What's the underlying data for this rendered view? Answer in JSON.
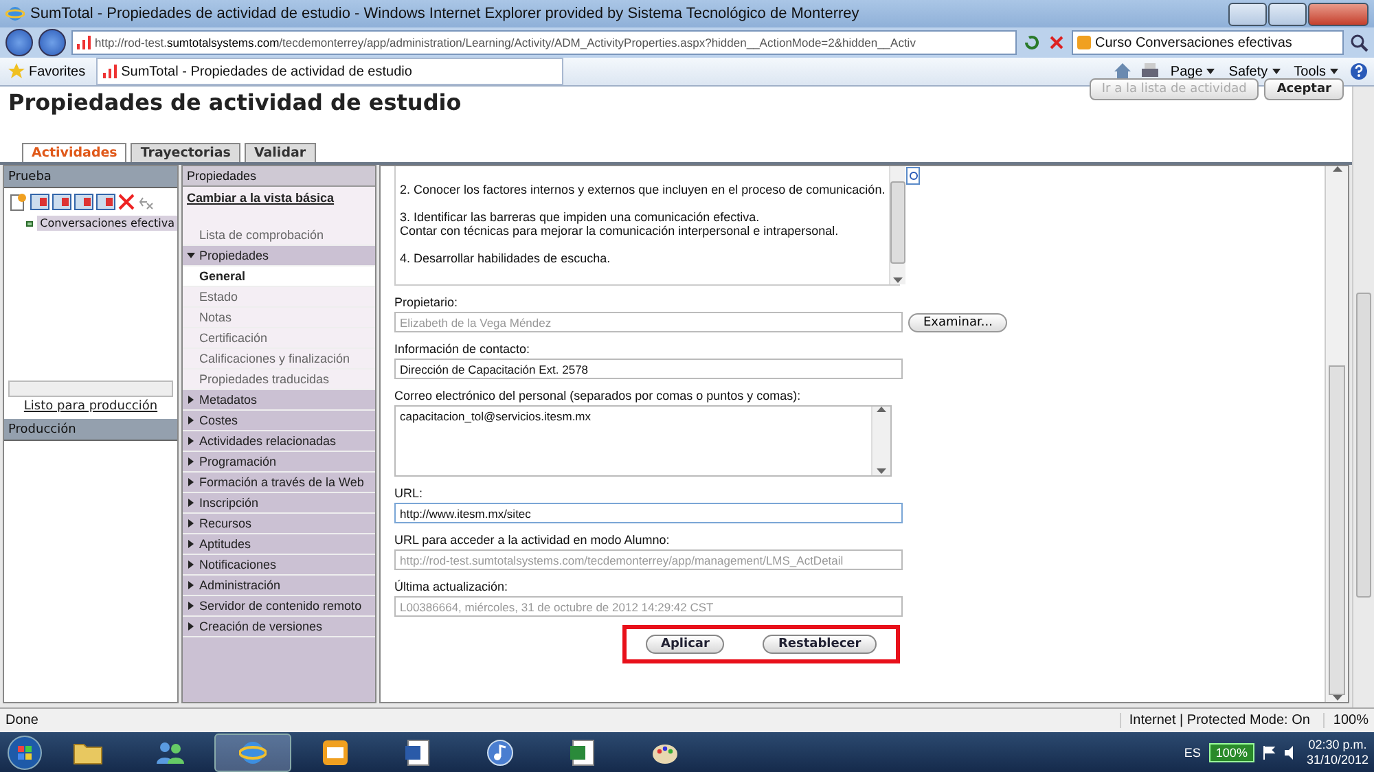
{
  "window": {
    "title": "SumTotal - Propiedades de actividad de estudio - Windows Internet Explorer provided by Sistema Tecnológico de Monterrey"
  },
  "address_bar": {
    "url_start": "http://rod-test.",
    "url_domain": "sumtotalsystems.com",
    "url_rest": "/tecdemonterrey/app/administration/Learning/Activity/ADM_ActivityProperties.aspx?hidden__ActionMode=2&hidden__Activ"
  },
  "search_field": {
    "value": "Curso Conversaciones efectivas"
  },
  "favorites_bar": {
    "favorites": "Favorites",
    "tab": "SumTotal - Propiedades de actividad de estudio",
    "commands": [
      "Page",
      "Safety",
      "Tools"
    ]
  },
  "page": {
    "heading": "Propiedades de actividad de estudio",
    "top_buttons": [
      {
        "label": "Ir a la lista de actividad",
        "disabled": true
      },
      {
        "label": "Aceptar",
        "disabled": false
      }
    ]
  },
  "tabs": [
    {
      "label": "Actividades",
      "selected": true
    },
    {
      "label": "Trayectorias",
      "selected": false
    },
    {
      "label": "Validar",
      "selected": false
    }
  ],
  "left_panel": {
    "title": "Prueba",
    "tree_item": "Conversaciones efectiva",
    "link": "Listo para producción",
    "second_title": "Producción"
  },
  "nav": {
    "header": "Propiedades",
    "link": "Cambiar a la vista básica",
    "items": [
      {
        "kind": "page",
        "label": "Lista de comprobación",
        "selected": false
      },
      {
        "kind": "section",
        "label": "Propiedades",
        "expanded": true,
        "children": [
          {
            "label": "General",
            "selected": true
          },
          {
            "label": "Estado",
            "selected": false
          },
          {
            "label": "Notas",
            "selected": false
          },
          {
            "label": "Certificación",
            "selected": false
          },
          {
            "label": "Calificaciones y finalización",
            "selected": false
          },
          {
            "label": "Propiedades traducidas",
            "selected": false
          }
        ]
      },
      {
        "kind": "section",
        "label": "Metadatos",
        "expanded": false
      },
      {
        "kind": "section",
        "label": "Costes",
        "expanded": false
      },
      {
        "kind": "section",
        "label": "Actividades relacionadas",
        "expanded": false
      },
      {
        "kind": "section",
        "label": "Programación",
        "expanded": false
      },
      {
        "kind": "section",
        "label": "Formación a través de la Web",
        "expanded": false
      },
      {
        "kind": "section",
        "label": "Inscripción",
        "expanded": false
      },
      {
        "kind": "section",
        "label": "Recursos",
        "expanded": false
      },
      {
        "kind": "section",
        "label": "Aptitudes",
        "expanded": false
      },
      {
        "kind": "section",
        "label": "Notificaciones",
        "expanded": false
      },
      {
        "kind": "section",
        "label": "Administración",
        "expanded": false
      },
      {
        "kind": "section",
        "label": "Servidor de contenido remoto",
        "expanded": false
      },
      {
        "kind": "section",
        "label": "Creación de versiones",
        "expanded": false
      }
    ]
  },
  "objectives": [
    {
      "lines": [
        "2. Conocer los factores internos y externos que incluyen en el proceso de comunicación."
      ]
    },
    {
      "lines": [
        "3. Identificar las barreras que impiden una comunicación efectiva.",
        "Contar con técnicas para mejorar la comunicación interpersonal e intrapersonal."
      ]
    },
    {
      "lines": [
        "4. Desarrollar habilidades de escucha."
      ]
    }
  ],
  "fields": [
    {
      "kind": "input",
      "label": "Propietario:",
      "value": "Elizabeth de la Vega Méndez",
      "disabled": true,
      "focused": false,
      "button": "Examinar..."
    },
    {
      "kind": "input",
      "label": "Información de contacto:",
      "value": "Dirección de Capacitación Ext. 2578",
      "disabled": false,
      "focused": false
    },
    {
      "kind": "textarea",
      "label": "Correo electrónico del personal (separados por comas o puntos y comas):",
      "value": "capacitacion_tol@servicios.itesm.mx",
      "disabled": false,
      "focused": false
    },
    {
      "kind": "input",
      "label": "URL:",
      "value": "http://www.itesm.mx/sitec",
      "disabled": false,
      "focused": true
    },
    {
      "kind": "input",
      "label": "URL para acceder a la actividad en modo Alumno:",
      "value": "http://rod-test.sumtotalsystems.com/tecdemonterrey/app/management/LMS_ActDetail",
      "disabled": true,
      "focused": false
    },
    {
      "kind": "input",
      "label": "Última actualización:",
      "value": "L00386664, miércoles, 31 de octubre de 2012 14:29:42 CST",
      "disabled": true,
      "focused": false
    }
  ],
  "actions": {
    "highlighted": true,
    "buttons": [
      "Aplicar",
      "Restablecer"
    ]
  },
  "status_bar": {
    "text": "Done",
    "zone": "Internet | Protected Mode: On",
    "zoom": "100%"
  },
  "taskbar": {
    "apps": [
      {
        "kind": "folder",
        "active": false
      },
      {
        "kind": "people",
        "active": false
      },
      {
        "kind": "browser",
        "active": true
      },
      {
        "kind": "mail",
        "active": false
      },
      {
        "kind": "word",
        "active": false
      },
      {
        "kind": "music",
        "active": false
      },
      {
        "kind": "sheet",
        "active": false
      },
      {
        "kind": "paint",
        "active": false
      }
    ],
    "language": "ES",
    "battery": "100%",
    "time": "02:30 p.m.",
    "date": "31/10/2012"
  }
}
